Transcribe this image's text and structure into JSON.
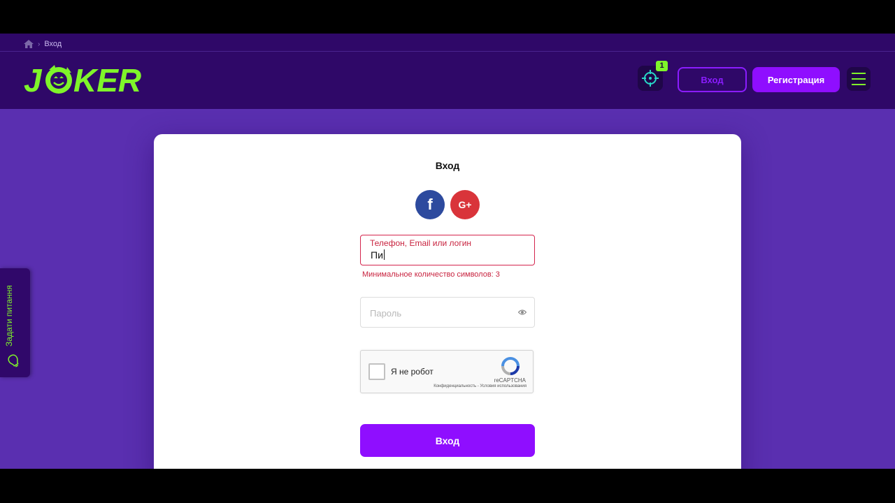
{
  "breadcrumb": {
    "current": "Вход"
  },
  "header": {
    "logo_text": "JOKER",
    "notifications_count": "1",
    "login_label": "Вход",
    "register_label": "Регистрация"
  },
  "side_tab": {
    "label": "Задати питання"
  },
  "login_card": {
    "title": "Вход",
    "social": {
      "facebook_glyph": "f",
      "google_glyph": "G+"
    },
    "login_field": {
      "label": "Телефон, Email или логин",
      "value": "Пи",
      "error": "Минимальное количество символов: 3"
    },
    "password_field": {
      "placeholder": "Пароль"
    },
    "captcha": {
      "checkbox_label": "Я не робот",
      "brand": "reCAPTCHA",
      "links": "Конфиденциальность - Условия использования"
    },
    "submit_label": "Вход"
  },
  "colors": {
    "brand_green": "#7ff52a",
    "primary_purple": "#8f0eff",
    "header_bg": "#2f0868",
    "page_bg": "#5a2fb0",
    "error_red": "#c8233f"
  },
  "icons": [
    "home-icon",
    "target-icon",
    "hamburger-icon",
    "bulb-icon",
    "facebook-icon",
    "google-plus-icon",
    "eye-icon",
    "recaptcha-icon"
  ]
}
